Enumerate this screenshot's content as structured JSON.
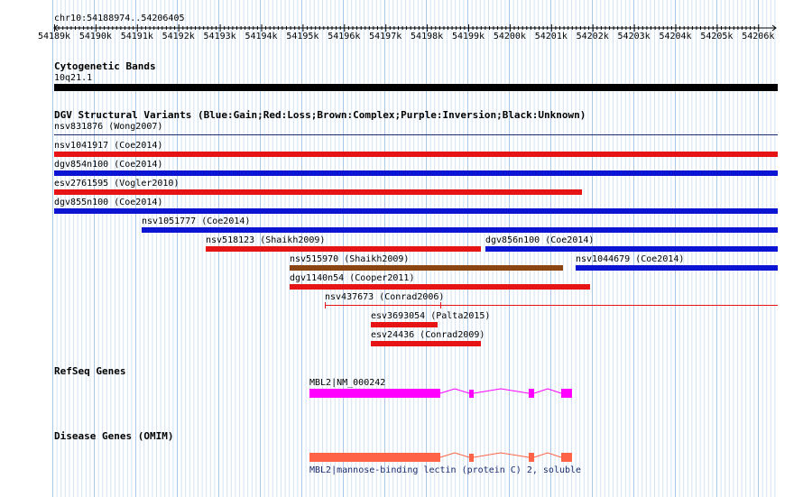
{
  "location": "chr10:54188974..54206405",
  "ruler_ticks": [
    "54189k",
    "54190k",
    "54191k",
    "54192k",
    "54193k",
    "54194k",
    "54195k",
    "54196k",
    "54197k",
    "54198k",
    "54199k",
    "54200k",
    "54201k",
    "54202k",
    "54203k",
    "54204k",
    "54205k",
    "54206k"
  ],
  "tracks": {
    "cytoband": {
      "title": "Cytogenetic Bands",
      "band_label": "10q21.1",
      "color": "#000000"
    },
    "dgv": {
      "title": "DGV Structural Variants (Blue:Gain;Red:Loss;Brown:Complex;Purple:Inversion;Black:Unknown)",
      "colors": {
        "gain": "#0a14d2",
        "loss": "#e61414",
        "complex": "#8b4513",
        "inversion": "#800080",
        "unknown": "#000000"
      },
      "features": [
        {
          "label": "nsv831876 (Wong2007)"
        },
        {
          "label": "nsv1041917 (Coe2014)"
        },
        {
          "label": "dgv854n100 (Coe2014)"
        },
        {
          "label": "esv2761595 (Vogler2010)"
        },
        {
          "label": "dgv855n100 (Coe2014)"
        },
        {
          "label": "nsv1051777 (Coe2014)"
        },
        {
          "label": "nsv518123 (Shaikh2009)"
        },
        {
          "label": "dgv856n100 (Coe2014)"
        },
        {
          "label": "nsv515970 (Shaikh2009)"
        },
        {
          "label": "nsv1044679 (Coe2014)"
        },
        {
          "label": "dgv1140n54 (Cooper2011)"
        },
        {
          "label": "nsv437673 (Conrad2006)"
        },
        {
          "label": "esv3693054 (Palta2015)"
        },
        {
          "label": "esv24436 (Conrad2009)"
        }
      ]
    },
    "refseq": {
      "title": "RefSeq Genes",
      "gene_label": "MBL2|NM_000242",
      "color": "#ff00ff"
    },
    "omim": {
      "title": "Disease Genes (OMIM)",
      "gene_label": "MBL2",
      "description": "mannose-binding lectin (protein C) 2, soluble",
      "color": "#ff6347"
    }
  }
}
